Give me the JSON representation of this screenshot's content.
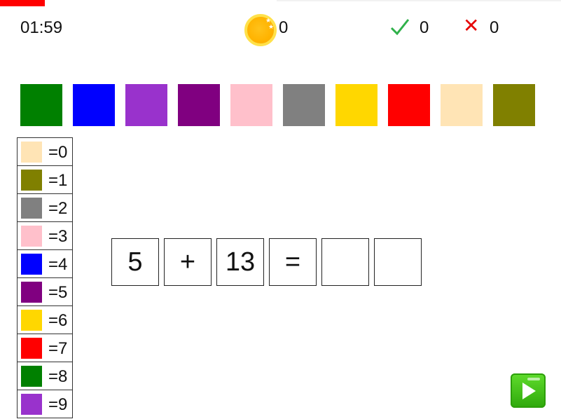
{
  "hud": {
    "timer": "01:59",
    "coins": "0",
    "correct": "0",
    "wrong": "0",
    "wrong_symbol": "✕",
    "progress_fraction": 0.08
  },
  "palette": [
    {
      "name": "green",
      "color": "#008000"
    },
    {
      "name": "blue",
      "color": "#0000ff"
    },
    {
      "name": "medium-purple",
      "color": "#9932cc"
    },
    {
      "name": "purple",
      "color": "#800080"
    },
    {
      "name": "pink",
      "color": "#ffc0cb"
    },
    {
      "name": "gray",
      "color": "#808080"
    },
    {
      "name": "gold",
      "color": "#ffd700"
    },
    {
      "name": "red",
      "color": "#ff0000"
    },
    {
      "name": "moccasin",
      "color": "#ffe4b5"
    },
    {
      "name": "olive",
      "color": "#808000"
    }
  ],
  "legend": [
    {
      "color": "#ffe4b5",
      "label": "=0"
    },
    {
      "color": "#808000",
      "label": "=1"
    },
    {
      "color": "#808080",
      "label": "=2"
    },
    {
      "color": "#ffc0cb",
      "label": "=3"
    },
    {
      "color": "#0000ff",
      "label": "=4"
    },
    {
      "color": "#800080",
      "label": "=5"
    },
    {
      "color": "#ffd700",
      "label": "=6"
    },
    {
      "color": "#ff0000",
      "label": "=7"
    },
    {
      "color": "#008000",
      "label": "=8"
    },
    {
      "color": "#9932cc",
      "label": "=9"
    }
  ],
  "equation": {
    "operand1": "5",
    "operator": "+",
    "operand2": "13",
    "equals": "=",
    "answer_tens": "",
    "answer_ones": ""
  }
}
